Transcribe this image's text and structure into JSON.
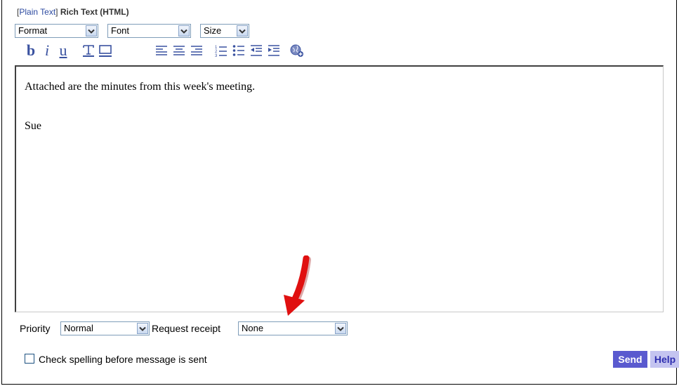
{
  "mode_switch": {
    "open_bracket": "[",
    "plain_text": "Plain Text",
    "close_bracket": "]",
    "rich_text": "Rich Text (HTML)"
  },
  "format_bar": {
    "format": "Format",
    "font": "Font",
    "size": "Size"
  },
  "toolbar": {
    "bold": "b",
    "italic": "i",
    "underline": "u",
    "icons": [
      "bold-icon",
      "italic-icon",
      "underline-icon",
      "text-color-icon",
      "highlight-icon",
      "align-left-icon",
      "align-center-icon",
      "align-right-icon",
      "numbered-list-icon",
      "bullet-list-icon",
      "outdent-icon",
      "indent-icon",
      "insert-link-icon"
    ]
  },
  "editor": {
    "line1": "Attached are the minutes from this week's meeting.",
    "line2": "Sue"
  },
  "options": {
    "priority_label": "Priority",
    "priority_value": "Normal",
    "receipt_label": "Request receipt",
    "receipt_value": "None",
    "spellcheck_label": "Check spelling before message is sent",
    "spellcheck_checked": false
  },
  "actions": {
    "send": "Send",
    "help": "Help"
  },
  "colors": {
    "toolbar_icon": "#3a52a0",
    "send_bg": "#5a5acf",
    "help_bg": "#c4c4f0",
    "annotation_arrow": "#e01010"
  }
}
